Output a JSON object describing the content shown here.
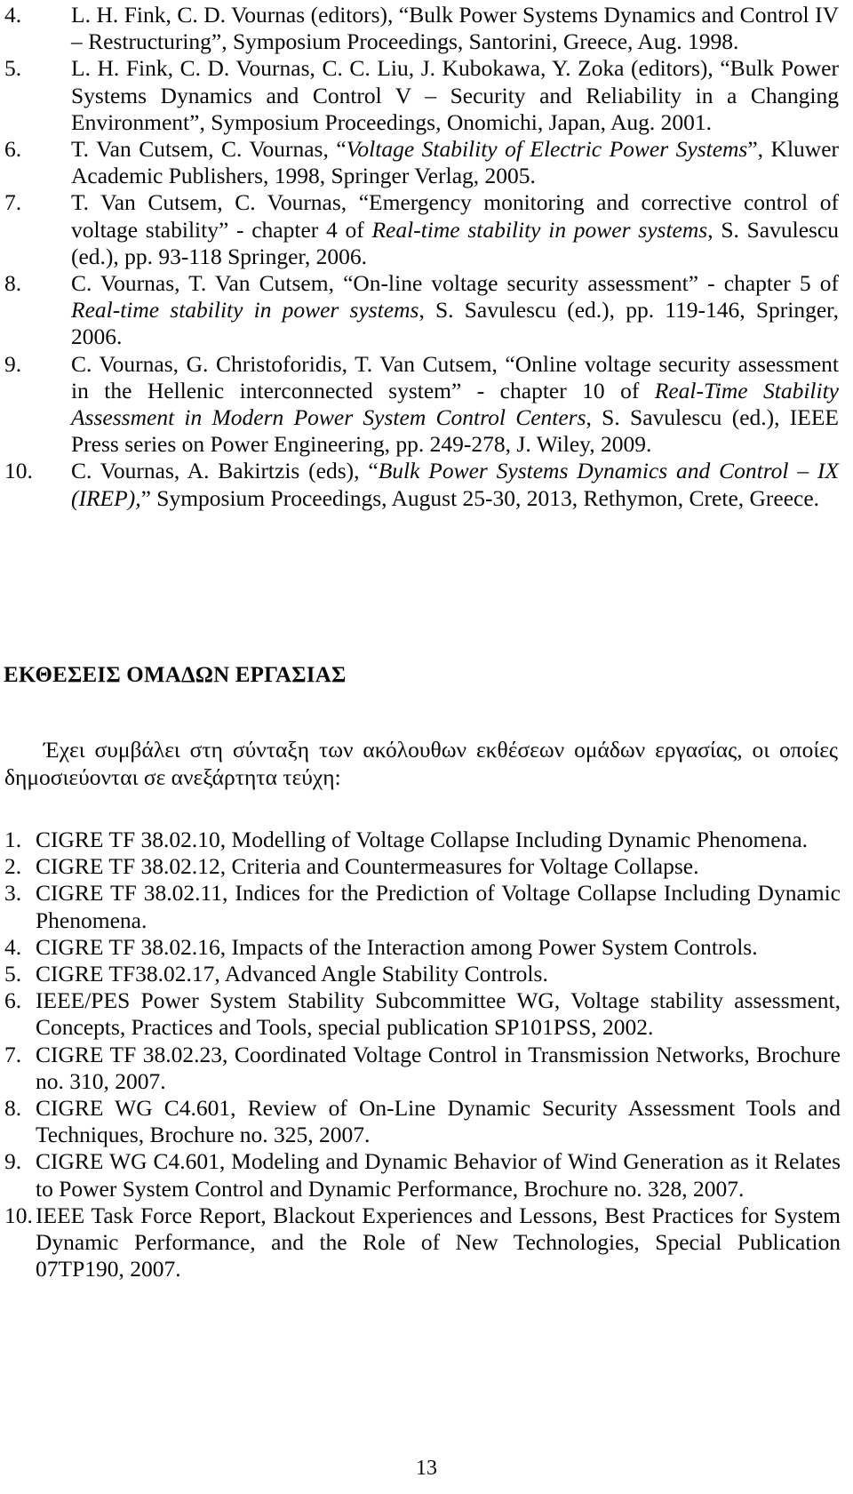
{
  "document": {
    "page_number": "13",
    "section_heading": "ΕΚΘΕΣΕΙΣ ΟΜΑΔΩΝ ΕΡΓΑΣΙΑΣ",
    "greek_paragraph": "Έχει συμβάλει στη σύνταξη των ακόλουθων εκθέσεων ομάδων εργασίας, οι οποίες δημοσιεύονται σε ανεξάρτητα τεύχη:"
  },
  "references": [
    {
      "number": "4.",
      "text": "L. H. Fink, C. D. Vournas (editors), “Bulk Power Systems Dynamics and Control IV – Restructuring”, Symposium Proceedings, Santorini, Greece, Aug. 1998."
    },
    {
      "number": "5.",
      "text": "L. H. Fink, C. D. Vournas, C. C. Liu, J. Kubokawa, Y. Zoka (editors), “Bulk Power Systems Dynamics and Control V – Security and Reliability in a Changing Environment”, Symposium Proceedings, Onomichi, Japan, Aug. 2001."
    },
    {
      "number": "6.",
      "text_before": "T. Van Cutsem, C. Vournas, “",
      "italic_1": "Voltage Stability of Electric Power Systems",
      "text_after": "”, Kluwer Academic Publishers, 1998, Springer Verlag, 2005."
    },
    {
      "number": "7.",
      "text_before": "T. Van Cutsem, C. Vournas, “Emergency monitoring and corrective control of voltage stability” - chapter 4 of ",
      "italic_1": "Real-time stability in power systems",
      "text_after": ", S. Savulescu (ed.), pp. 93-118 Springer, 2006."
    },
    {
      "number": "8.",
      "text_before": "C. Vournas, T. Van Cutsem, “On-line voltage security assessment” - chapter 5 of ",
      "italic_1": "Real-time stability in power systems",
      "text_after": ", S. Savulescu (ed.), pp. 119-146, Springer, 2006."
    },
    {
      "number": "9.",
      "text_before": "C. Vournas, G. Christoforidis, T. Van Cutsem, “Online voltage security assessment in the Hellenic interconnected system” - chapter 10 of ",
      "italic_1": "Real-Time Stability Assessment in Modern Power System Control Centers",
      "text_after": ", S. Savulescu (ed.), IEEE Press series on Power Engineering, pp. 249-278, J. Wiley, 2009."
    },
    {
      "number": "10.",
      "text_before": "C. Vournas, A. Bakirtzis (eds), “",
      "italic_1": "Bulk Power Systems Dynamics and Control – IX (IREP),",
      "text_after": "” Symposium Proceedings, August 25-30, 2013, Rethymon, Crete, Greece."
    }
  ],
  "working_group_reports": [
    {
      "number": "1.",
      "text": "CIGRE TF 38.02.10, Modelling of Voltage Collapse Including Dynamic Phenomena."
    },
    {
      "number": "2.",
      "text": "CIGRE TF 38.02.12, Criteria and Countermeasures for Voltage Collapse."
    },
    {
      "number": "3.",
      "text": "CIGRE TF 38.02.11, Indices for the Prediction of Voltage Collapse Including Dynamic Phenomena."
    },
    {
      "number": "4.",
      "text": "CIGRE TF 38.02.16, Impacts of the Interaction among Power System Controls."
    },
    {
      "number": "5.",
      "text": "CIGRE TF38.02.17, Advanced Angle Stability Controls."
    },
    {
      "number": "6.",
      "text": "IEEE/PES Power System Stability Subcommittee WG, Voltage stability assessment, Concepts, Practices and Tools, special publication SP101PSS, 2002."
    },
    {
      "number": "7.",
      "text": "CIGRE TF 38.02.23, Coordinated Voltage Control in Transmission Networks, Brochure no. 310, 2007."
    },
    {
      "number": "8.",
      "text": "CIGRE WG C4.601, Review of On-Line Dynamic Security Assessment Tools and Techniques, Brochure no. 325, 2007."
    },
    {
      "number": "9.",
      "text": "CIGRE WG C4.601, Modeling and Dynamic Behavior of Wind Generation as it Relates to Power System Control and Dynamic Performance, Brochure no. 328, 2007."
    },
    {
      "number": "10.",
      "text": "IEEE Task Force Report, Blackout Experiences and Lessons, Best Practices for System Dynamic Performance, and the Role of New Technologies, Special Publication 07TP190, 2007."
    }
  ]
}
